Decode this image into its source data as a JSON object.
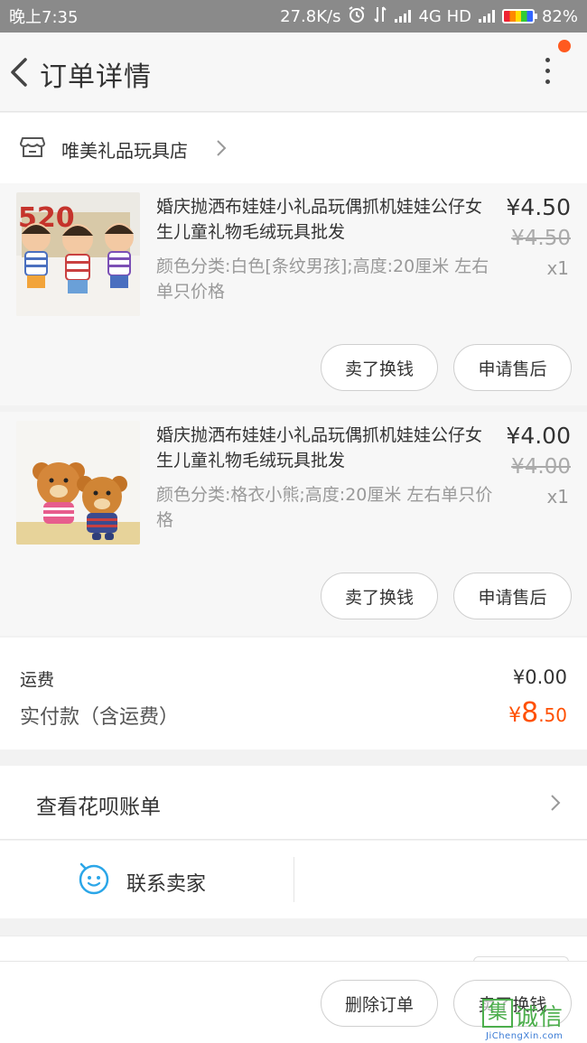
{
  "status_bar": {
    "time": "晚上7:35",
    "net_speed": "27.8K/s",
    "network": "4G HD",
    "battery": "82%"
  },
  "header": {
    "title": "订单详情"
  },
  "shop": {
    "name": "唯美礼品玩具店"
  },
  "items": [
    {
      "title": "婚庆抛洒布娃娃小礼品玩偶抓机娃娃公仔女生儿童礼物毛绒玩具批发",
      "spec": "颜色分类:白色[条纹男孩];高度:20厘米 左右单只价格",
      "price": "¥4.50",
      "original_price": "¥4.50",
      "quantity": "x1",
      "image_text": "520",
      "buttons": [
        "卖了换钱",
        "申请售后"
      ]
    },
    {
      "title": "婚庆抛洒布娃娃小礼品玩偶抓机娃娃公仔女生儿童礼物毛绒玩具批发",
      "spec": "颜色分类:格衣小熊;高度:20厘米 左右单只价格",
      "price": "¥4.00",
      "original_price": "¥4.00",
      "quantity": "x1",
      "buttons": [
        "卖了换钱",
        "申请售后"
      ]
    }
  ],
  "totals": {
    "shipping_label": "运费",
    "shipping_value": "¥0.00",
    "paid_label": "实付款（含运费）",
    "paid_currency": "¥",
    "paid_integer": "8",
    "paid_decimal": ".50"
  },
  "huabei": {
    "label": "查看花呗账单"
  },
  "contact": {
    "label": "联系卖家"
  },
  "bottom_bar": {
    "delete_label": "删除订单",
    "sell_label": "卖了换钱"
  },
  "watermark": {
    "box": "集",
    "cn": "诚信",
    "en": "JiChengXin.com"
  },
  "colors": {
    "accent": "#ff5000",
    "notification_dot": "#ff5a1f",
    "contact_icon": "#2ba6e8"
  }
}
